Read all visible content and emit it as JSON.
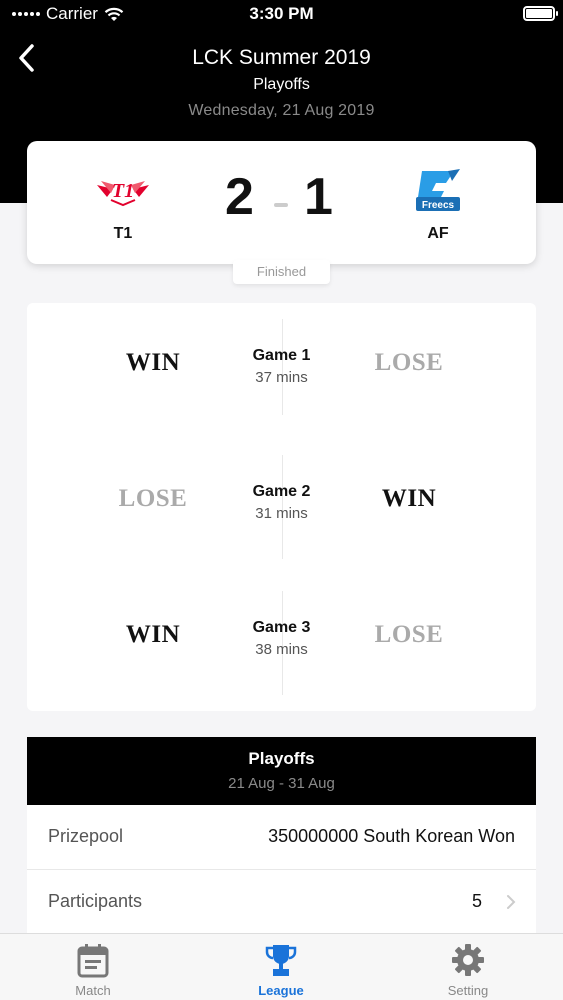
{
  "status_bar": {
    "carrier": "Carrier",
    "time": "3:30 PM"
  },
  "nav": {
    "title": "LCK Summer 2019",
    "subtitle": "Playoffs",
    "date": "Wednesday, 21 Aug 2019"
  },
  "match": {
    "home": {
      "name": "T1",
      "score": "2",
      "logo": "t1-logo"
    },
    "away": {
      "name": "AF",
      "score": "1",
      "logo": "afreeca-freecs-logo"
    },
    "status": "Finished"
  },
  "games": [
    {
      "name": "Game 1",
      "duration": "37 mins",
      "home_result": "WIN",
      "away_result": "LOSE"
    },
    {
      "name": "Game 2",
      "duration": "31 mins",
      "home_result": "LOSE",
      "away_result": "WIN"
    },
    {
      "name": "Game 3",
      "duration": "38 mins",
      "home_result": "WIN",
      "away_result": "LOSE"
    }
  ],
  "league": {
    "stage": "Playoffs",
    "range": "21 Aug - 31 Aug",
    "prizepool_label": "Prizepool",
    "prizepool_value": "350000000 South Korean Won",
    "participants_label": "Participants",
    "participants_value": "5"
  },
  "tabs": [
    {
      "label": "Match",
      "icon": "calendar-icon",
      "active": false
    },
    {
      "label": "League",
      "icon": "trophy-icon",
      "active": true
    },
    {
      "label": "Setting",
      "icon": "gear-icon",
      "active": false
    }
  ],
  "colors": {
    "accent": "#1a73d9",
    "win": "#111111",
    "lose": "#aaaaaa",
    "header": "#000000"
  }
}
